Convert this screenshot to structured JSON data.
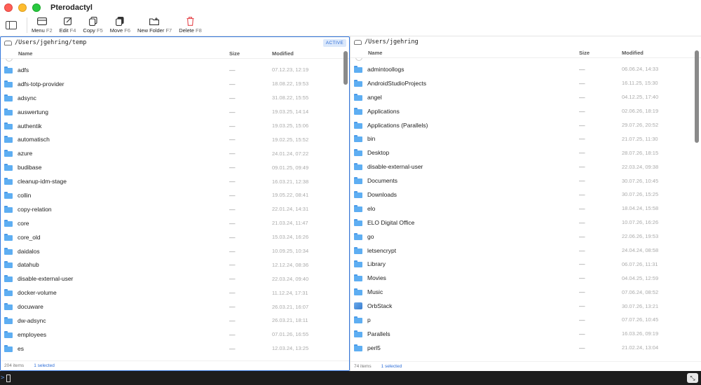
{
  "window": {
    "title": "Pterodactyl"
  },
  "toolbar": {
    "buttons": [
      {
        "label": "Menu",
        "key": "F2",
        "icon": "menu-icon"
      },
      {
        "label": "Edit",
        "key": "F4",
        "icon": "edit-icon"
      },
      {
        "label": "Copy",
        "key": "F5",
        "icon": "copy-icon"
      },
      {
        "label": "Move",
        "key": "F6",
        "icon": "move-icon"
      },
      {
        "label": "New Folder",
        "key": "F7",
        "icon": "new-folder-icon"
      },
      {
        "label": "Delete",
        "key": "F8",
        "icon": "trash-icon"
      }
    ]
  },
  "left_pane": {
    "path": "/Users/jgehring/temp",
    "badge": "ACTIVE",
    "columns": {
      "name": "Name",
      "size": "Size",
      "modified": "Modified"
    },
    "rows": [
      {
        "name": "adfs",
        "size": "—",
        "modified": "07.12.23, 12:19"
      },
      {
        "name": "adfs-totp-provider",
        "size": "—",
        "modified": "18.08.22, 19:53"
      },
      {
        "name": "adsync",
        "size": "—",
        "modified": "31.08.22, 15:55"
      },
      {
        "name": "auswertung",
        "size": "—",
        "modified": "19.03.25, 14:14"
      },
      {
        "name": "authentik",
        "size": "—",
        "modified": "19.03.25, 15:06"
      },
      {
        "name": "automatisch",
        "size": "—",
        "modified": "19.02.25, 15:52"
      },
      {
        "name": "azure",
        "size": "—",
        "modified": "24.01.24, 07:22"
      },
      {
        "name": "budibase",
        "size": "—",
        "modified": "09.01.25, 09:49"
      },
      {
        "name": "cleanup-idm-stage",
        "size": "—",
        "modified": "16.03.21, 12:38"
      },
      {
        "name": "collin",
        "size": "—",
        "modified": "19.05.22, 08:41"
      },
      {
        "name": "copy-relation",
        "size": "—",
        "modified": "22.01.24, 14:31"
      },
      {
        "name": "core",
        "size": "—",
        "modified": "21.03.24, 11:47"
      },
      {
        "name": "core_old",
        "size": "—",
        "modified": "15.03.24, 16:26"
      },
      {
        "name": "daidalos",
        "size": "—",
        "modified": "10.09.25, 10:34"
      },
      {
        "name": "datahub",
        "size": "—",
        "modified": "12.12.24, 08:36"
      },
      {
        "name": "disable-external-user",
        "size": "—",
        "modified": "22.03.24, 09:40"
      },
      {
        "name": "docker-volume",
        "size": "—",
        "modified": "11.12.24, 17:31"
      },
      {
        "name": "docuware",
        "size": "—",
        "modified": "26.03.21, 16:07"
      },
      {
        "name": "dw-adsync",
        "size": "—",
        "modified": "26.03.21, 18:11"
      },
      {
        "name": "employees",
        "size": "—",
        "modified": "07.01.26, 16:55"
      },
      {
        "name": "es",
        "size": "—",
        "modified": "12.03.24, 13:25"
      }
    ],
    "status": {
      "items": "204 items",
      "selected": "1 selected"
    }
  },
  "right_pane": {
    "path": "/Users/jgehring",
    "columns": {
      "name": "Name",
      "size": "Size",
      "modified": "Modified"
    },
    "rows": [
      {
        "name": "admintoollogs",
        "size": "—",
        "modified": "06.06.24, 14:33",
        "icon": "folder"
      },
      {
        "name": "AndroidStudioProjects",
        "size": "—",
        "modified": "16.11.25, 15:30",
        "icon": "folder"
      },
      {
        "name": "angel",
        "size": "—",
        "modified": "04.12.25, 17:40",
        "icon": "folder"
      },
      {
        "name": "Applications",
        "size": "—",
        "modified": "02.06.26, 18:19",
        "icon": "folder"
      },
      {
        "name": "Applications (Parallels)",
        "size": "—",
        "modified": "29.07.26, 20:52",
        "icon": "folder"
      },
      {
        "name": "bin",
        "size": "—",
        "modified": "21.07.25, 11:30",
        "icon": "folder"
      },
      {
        "name": "Desktop",
        "size": "—",
        "modified": "28.07.26, 18:15",
        "icon": "folder"
      },
      {
        "name": "disable-external-user",
        "size": "—",
        "modified": "22.03.24, 09:38",
        "icon": "folder"
      },
      {
        "name": "Documents",
        "size": "—",
        "modified": "30.07.26, 10:45",
        "icon": "folder"
      },
      {
        "name": "Downloads",
        "size": "—",
        "modified": "30.07.26, 15:25",
        "icon": "folder"
      },
      {
        "name": "elo",
        "size": "—",
        "modified": "18.04.24, 15:58",
        "icon": "folder"
      },
      {
        "name": "ELO Digital Office",
        "size": "—",
        "modified": "10.07.26, 16:26",
        "icon": "folder"
      },
      {
        "name": "go",
        "size": "—",
        "modified": "22.06.26, 19:53",
        "icon": "folder"
      },
      {
        "name": "letsencrypt",
        "size": "—",
        "modified": "24.04.24, 08:58",
        "icon": "folder"
      },
      {
        "name": "Library",
        "size": "—",
        "modified": "06.07.26, 11:31",
        "icon": "folder"
      },
      {
        "name": "Movies",
        "size": "—",
        "modified": "04.04.25, 12:59",
        "icon": "folder"
      },
      {
        "name": "Music",
        "size": "—",
        "modified": "07.06.24, 08:52",
        "icon": "folder"
      },
      {
        "name": "OrbStack",
        "size": "—",
        "modified": "30.07.26, 13:21",
        "icon": "app"
      },
      {
        "name": "p",
        "size": "—",
        "modified": "07.07.26, 10:45",
        "icon": "folder"
      },
      {
        "name": "Parallels",
        "size": "—",
        "modified": "16.03.26, 09:19",
        "icon": "folder"
      },
      {
        "name": "perl5",
        "size": "—",
        "modified": "21.02.24, 13:04",
        "icon": "folder"
      }
    ],
    "status": {
      "items": "74 items",
      "selected": "1 selected"
    }
  },
  "terminal": {
    "prompt": ">"
  }
}
